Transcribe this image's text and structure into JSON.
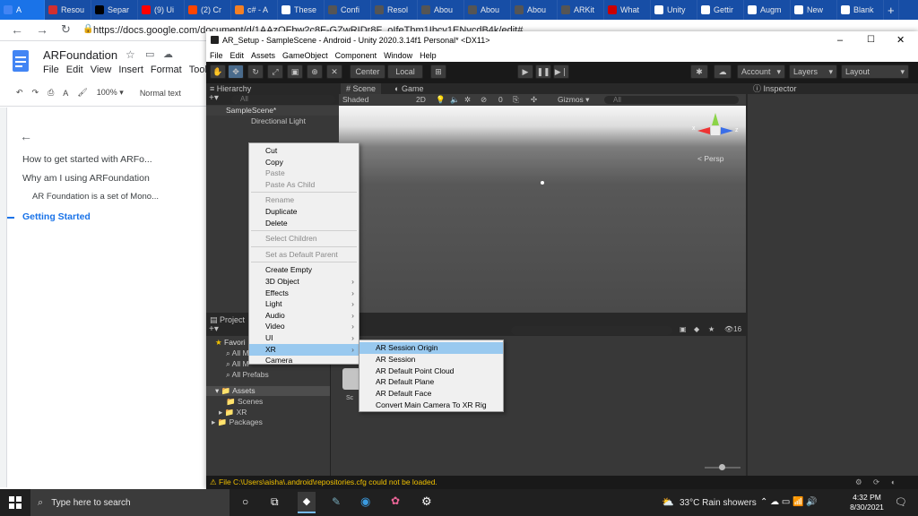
{
  "browser": {
    "tabs": [
      {
        "label": "A",
        "active": true,
        "fav": "#4285f4"
      },
      {
        "label": "Resou",
        "fav": "#d32f2f"
      },
      {
        "label": "Separ",
        "fav": "#000000",
        "badge": "DEV"
      },
      {
        "label": "(9) Ui",
        "fav": "#ff0000"
      },
      {
        "label": "(2) Cr",
        "fav": "#ff4500"
      },
      {
        "label": "c# - A",
        "fav": "#f48024"
      },
      {
        "label": "These",
        "fav": "#ffffff"
      },
      {
        "label": "Confi",
        "fav": "#555555"
      },
      {
        "label": "Resol",
        "fav": "#555555"
      },
      {
        "label": "Abou",
        "fav": "#555555"
      },
      {
        "label": "Abou",
        "fav": "#555555"
      },
      {
        "label": "Abou",
        "fav": "#555555"
      },
      {
        "label": "ARKit",
        "fav": "#555555"
      },
      {
        "label": "What",
        "fav": "#cc0000"
      },
      {
        "label": "Unity",
        "fav": "#ffffff"
      },
      {
        "label": "Gettir",
        "fav": "#ffffff"
      },
      {
        "label": "Augm",
        "fav": "#ffffff"
      },
      {
        "label": "New",
        "fav": "#ffffff"
      },
      {
        "label": "Blank",
        "fav": "#ffffff"
      }
    ],
    "new_tab": "+",
    "url": "https://docs.google.com/document/d/1AAzQFbw2c8F-GZwRIDr8F_oIfeThm1Ibcv1ENvcdB4k/edit#"
  },
  "docs": {
    "title": "ARFoundation",
    "menu": [
      "File",
      "Edit",
      "View",
      "Insert",
      "Format",
      "Tools"
    ],
    "zoom": "100%",
    "style": "Normal text",
    "outline": [
      {
        "text": "How to get started with ARFo...",
        "level": 1
      },
      {
        "text": "Why am I using ARFoundation",
        "level": 1
      },
      {
        "text": "AR Foundation is a set of Mono...",
        "level": 2
      },
      {
        "text": "Getting Started",
        "level": 1,
        "active": true
      }
    ]
  },
  "unity": {
    "title": "AR_Setup - SampleScene - Android - Unity 2020.3.14f1 Personal* <DX11>",
    "menu": [
      "File",
      "Edit",
      "Assets",
      "GameObject",
      "Component",
      "Window",
      "Help"
    ],
    "toolbar": {
      "center": "Center",
      "local": "Local",
      "account": "Account",
      "layers": "Layers",
      "layout": "Layout"
    },
    "hierarchy": {
      "tab": "Hierarchy",
      "search": "All",
      "scene": "SampleScene*",
      "items": [
        "Directional Light"
      ]
    },
    "scene": {
      "tab_scene": "Scene",
      "tab_game": "Game",
      "shading": "Shaded",
      "mode2d": "2D",
      "gizmos": "Gizmos",
      "search": "All",
      "persp": "< Persp",
      "layers_count": "0"
    },
    "inspector": {
      "tab": "Inspector"
    },
    "project": {
      "tab": "Project",
      "favorites": "Favori",
      "fav_items": [
        "All M",
        "All M",
        "All Prefabs"
      ],
      "assets": "Assets",
      "asset_items": [
        "Scenes",
        "XR"
      ],
      "packages": "Packages",
      "count": "16",
      "thumb_label": "Sc"
    },
    "status": "File C:\\Users\\aisha\\.android\\repositories.cfg could not be loaded."
  },
  "context_menu": {
    "items": [
      {
        "label": "Cut"
      },
      {
        "label": "Copy"
      },
      {
        "label": "Paste",
        "disabled": true
      },
      {
        "label": "Paste As Child",
        "disabled": true
      },
      {
        "sep": true
      },
      {
        "label": "Rename",
        "disabled": true
      },
      {
        "label": "Duplicate"
      },
      {
        "label": "Delete"
      },
      {
        "sep": true
      },
      {
        "label": "Select Children",
        "disabled": true
      },
      {
        "sep": true
      },
      {
        "label": "Set as Default Parent",
        "disabled": true
      },
      {
        "sep": true
      },
      {
        "label": "Create Empty"
      },
      {
        "label": "3D Object",
        "sub": true
      },
      {
        "label": "Effects",
        "sub": true
      },
      {
        "label": "Light",
        "sub": true
      },
      {
        "label": "Audio",
        "sub": true
      },
      {
        "label": "Video",
        "sub": true
      },
      {
        "label": "UI",
        "sub": true
      },
      {
        "label": "XR",
        "sub": true,
        "highlight": true
      },
      {
        "label": "Camera"
      }
    ]
  },
  "xr_submenu": {
    "items": [
      "AR Session Origin",
      "AR Session",
      "AR Default Point Cloud",
      "AR Default Plane",
      "AR Default Face",
      "Convert Main Camera To XR Rig"
    ],
    "highlighted": 0
  },
  "taskbar": {
    "search_placeholder": "Type here to search",
    "weather": "33°C  Rain showers",
    "time": "4:32 PM",
    "date": "8/30/2021"
  }
}
